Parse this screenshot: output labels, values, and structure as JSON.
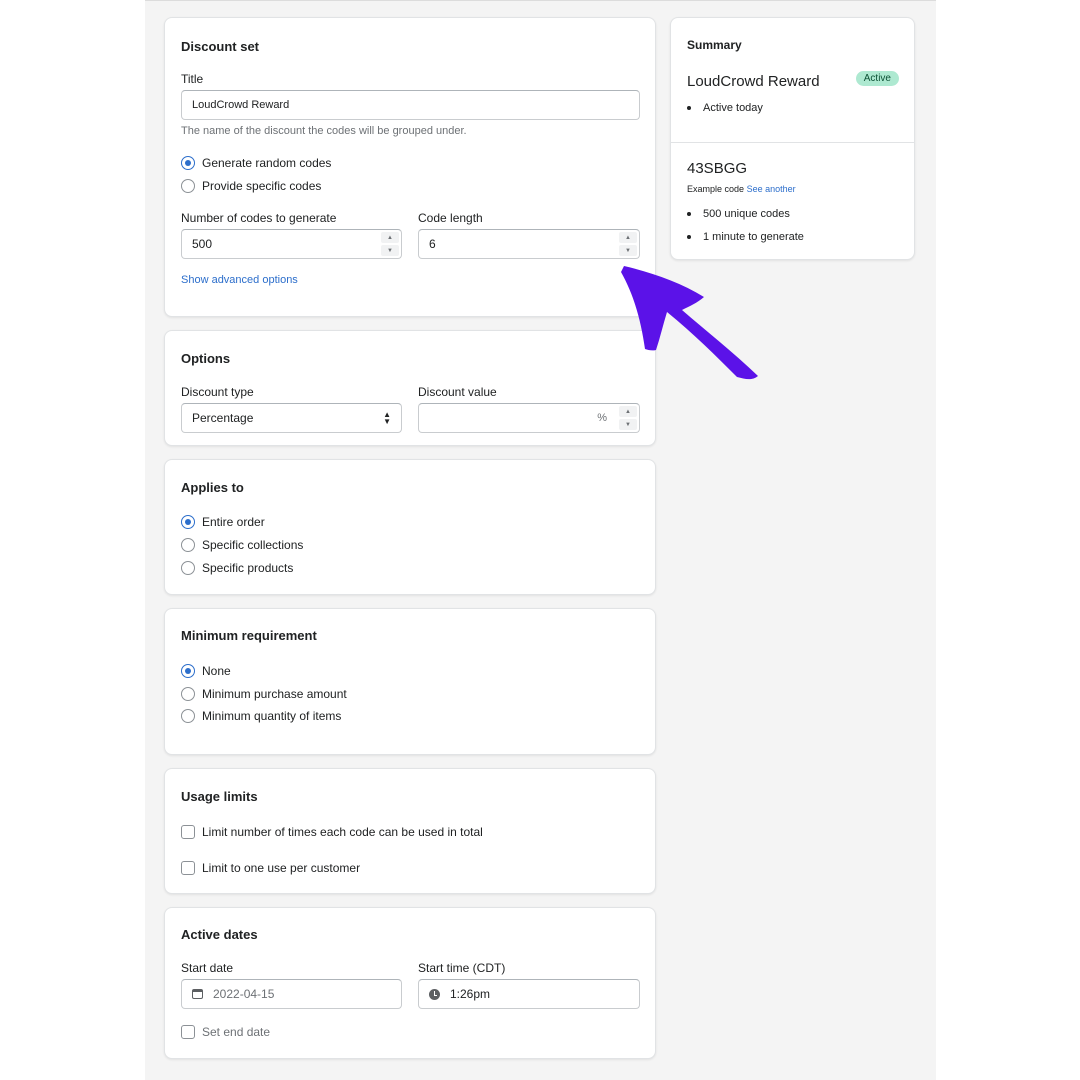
{
  "discount_set": {
    "title": "Discount set",
    "title_label": "Title",
    "title_value": "LoudCrowd Reward",
    "title_help": "The name of the discount the codes will be grouped under.",
    "radio_generate": "Generate random codes",
    "radio_specific": "Provide specific codes",
    "num_codes_label": "Number of codes to generate",
    "num_codes_value": "500",
    "code_length_label": "Code length",
    "code_length_value": "6",
    "advanced_link": "Show advanced options"
  },
  "options": {
    "title": "Options",
    "type_label": "Discount type",
    "type_value": "Percentage",
    "value_label": "Discount value",
    "value_value": "",
    "value_suffix": "%"
  },
  "applies_to": {
    "title": "Applies to",
    "items": [
      "Entire order",
      "Specific collections",
      "Specific products"
    ],
    "selected": "Entire order"
  },
  "minimum": {
    "title": "Minimum requirement",
    "items": [
      "None",
      "Minimum purchase amount",
      "Minimum quantity of items"
    ],
    "selected": "None"
  },
  "usage": {
    "title": "Usage limits",
    "limit_total": "Limit number of times each code can be used in total",
    "limit_customer": "Limit to one use per customer"
  },
  "dates": {
    "title": "Active dates",
    "start_date_label": "Start date",
    "start_date_value": "2022-04-15",
    "start_time_label": "Start time (CDT)",
    "start_time_value": "1:26pm",
    "end_date": "Set end date"
  },
  "summary": {
    "title": "Summary",
    "name": "LoudCrowd Reward",
    "badge": "Active",
    "active_line": "Active today",
    "code": "43SBGG",
    "example_label": "Example code",
    "see_another": "See another",
    "unique_codes": "500 unique codes",
    "generate_time": "1 minute to generate"
  },
  "colors": {
    "accent": "#2c6ecb",
    "badge_bg": "#aee9d1",
    "arrow": "#5b12e8"
  }
}
